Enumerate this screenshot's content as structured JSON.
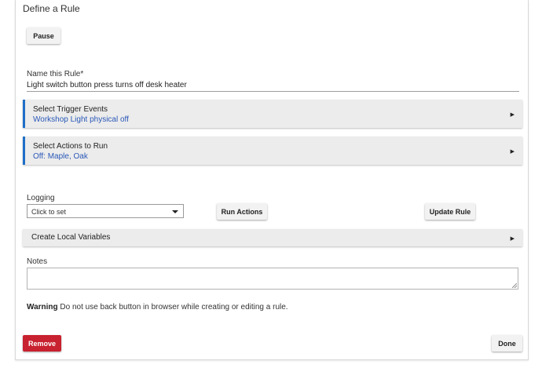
{
  "page": {
    "title": "Define a Rule"
  },
  "buttons": {
    "pause": "Pause",
    "run_actions": "Run Actions",
    "update_rule": "Update Rule",
    "remove": "Remove",
    "done": "Done"
  },
  "rule_name": {
    "label": "Name this Rule*",
    "value": "Light switch button press turns off desk heater"
  },
  "sections": {
    "trigger": {
      "title": "Select Trigger Events",
      "summary": "Workshop Light physical off"
    },
    "actions": {
      "title": "Select Actions to Run",
      "summary": "Off: Maple, Oak"
    },
    "variables": {
      "title": "Create Local Variables"
    }
  },
  "logging": {
    "label": "Logging",
    "selected": "Click to set"
  },
  "notes": {
    "label": "Notes",
    "value": ""
  },
  "warning": {
    "label": "Warning",
    "text": " Do not use back button in browser while creating or editing a rule."
  },
  "icons": {
    "expand": "caret-right-icon",
    "dropdown": "chevron-down-icon"
  },
  "colors": {
    "accent": "#1f6fc7",
    "link_text": "#2a58b8",
    "danger": "#c8212f",
    "section_bg": "#ececec"
  }
}
